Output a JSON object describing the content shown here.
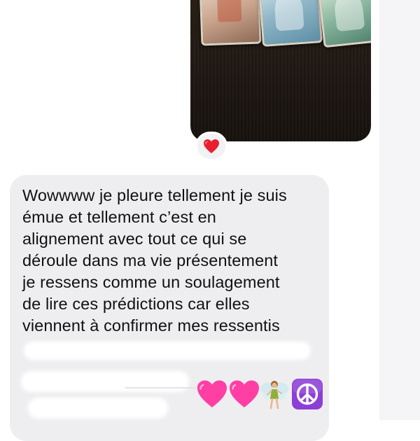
{
  "photo_message": {
    "description_icon": "tarot-cards-photo"
  },
  "reaction": {
    "emoji": "❤️",
    "icon": "red-heart-icon",
    "color": "#e8202e"
  },
  "incoming_message": {
    "text": "Wowwww je pleure tellement je suis\némue et tellement c’est en\nalignement avec tout ce qui se\ndéroule dans ma vie présentement\nje ressens comme un soulagement\nde lire ces prédictions car elles\nviennent à confirmer mes ressentis",
    "bubble_color": "#eeeef0"
  },
  "emojis": [
    {
      "icon": "pink-heart-icon",
      "char": "🩷",
      "color": "#ff3fa4"
    },
    {
      "icon": "pink-heart-icon",
      "char": "🩷",
      "color": "#ff3fa4"
    },
    {
      "icon": "fairy-icon",
      "char": "🧚",
      "color": "#8fae3a"
    },
    {
      "icon": "peace-symbol-icon",
      "char": "☮️",
      "color": "#8c3fd6"
    }
  ]
}
